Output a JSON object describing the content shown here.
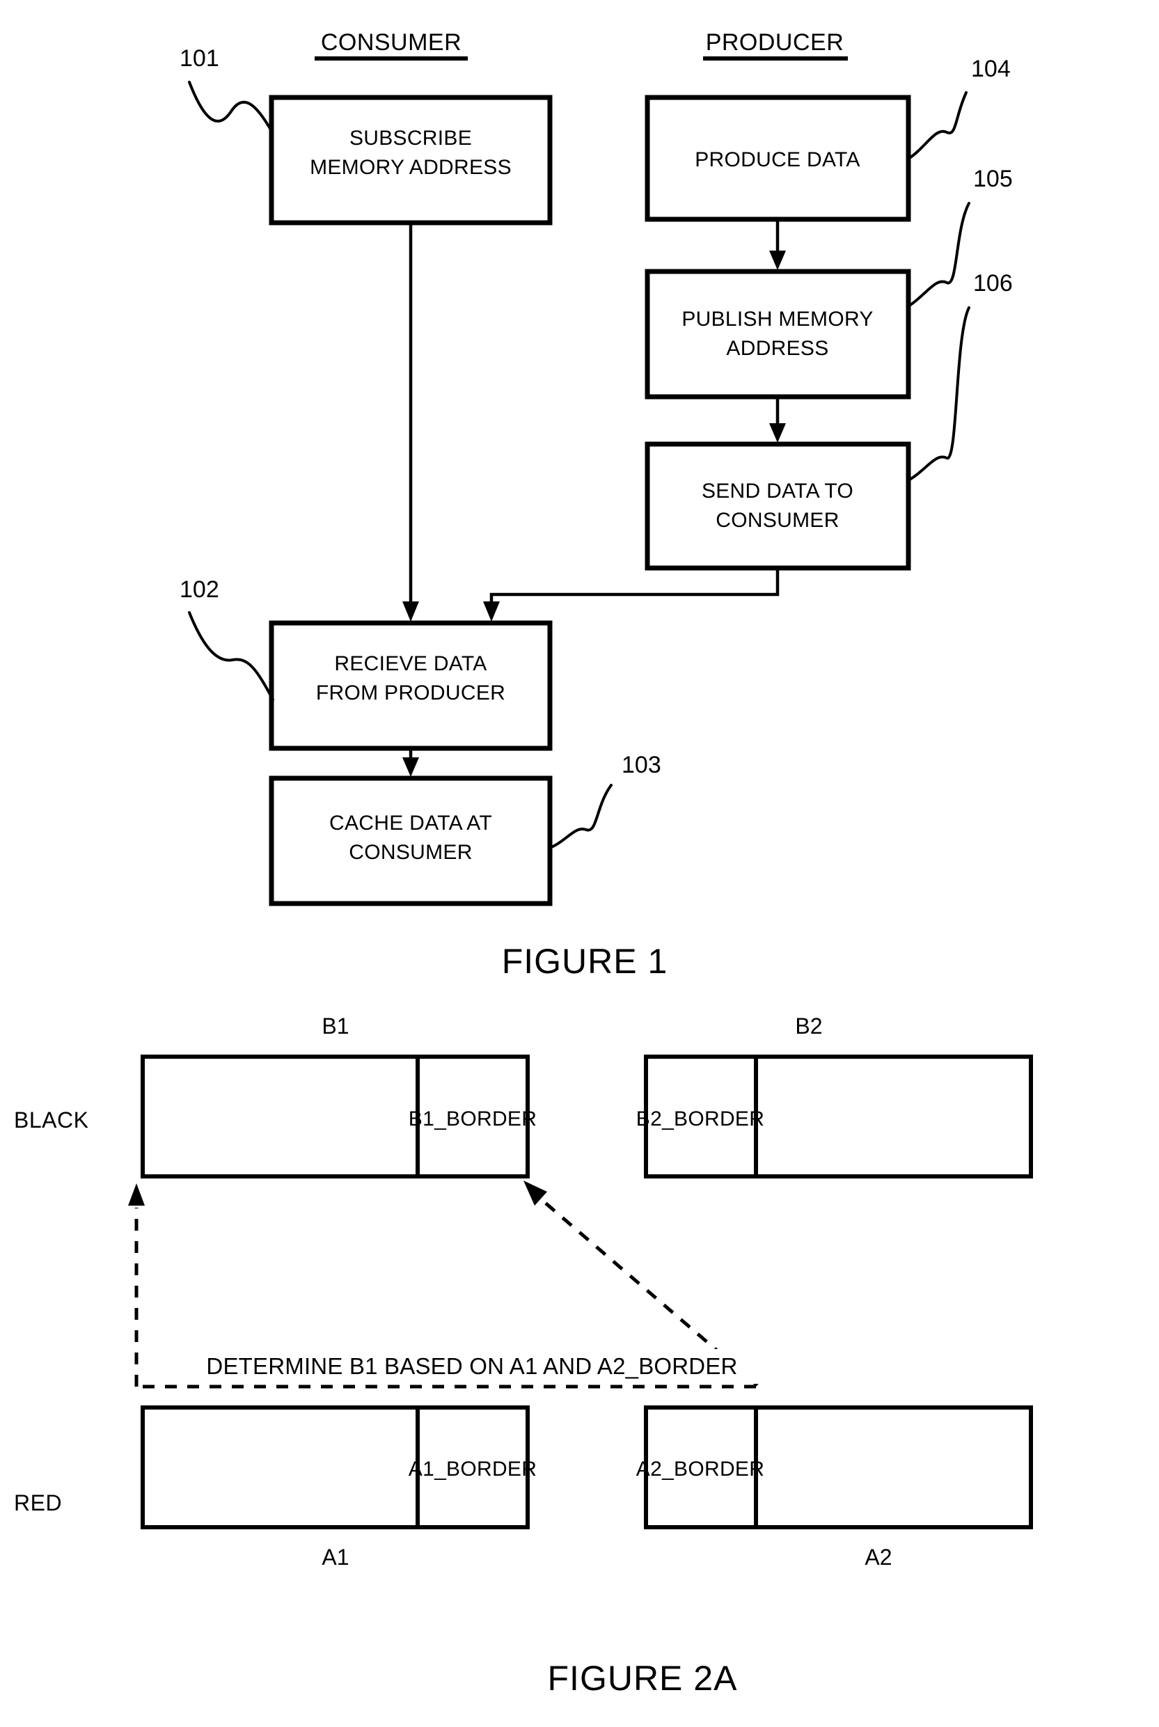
{
  "figure1": {
    "caption": "FIGURE 1",
    "columns": {
      "consumer": "CONSUMER",
      "producer": "PRODUCER"
    },
    "boxes": [
      {
        "id": "subscribe",
        "ref": "101",
        "lines": [
          "SUBSCRIBE",
          "MEMORY ADDRESS"
        ]
      },
      {
        "id": "receive",
        "ref": "102",
        "lines": [
          "RECIEVE DATA",
          "FROM PRODUCER"
        ]
      },
      {
        "id": "cache",
        "ref": "103",
        "lines": [
          "CACHE DATA AT",
          "CONSUMER"
        ]
      },
      {
        "id": "produce",
        "ref": "104",
        "lines": [
          "PRODUCE DATA"
        ]
      },
      {
        "id": "publish",
        "ref": "105",
        "lines": [
          "PUBLISH MEMORY",
          "ADDRESS"
        ]
      },
      {
        "id": "send",
        "ref": "106",
        "lines": [
          "SEND DATA TO",
          "CONSUMER"
        ]
      }
    ]
  },
  "figure2a": {
    "caption": "FIGURE 2A",
    "rows": [
      {
        "id": "black",
        "label": "BLACK"
      },
      {
        "id": "red",
        "label": "RED"
      }
    ],
    "groups": {
      "b1": {
        "label": "B1",
        "cell": "B1_BORDER",
        "cell_side": "right"
      },
      "b2": {
        "label": "B2",
        "cell": "B2_BORDER",
        "cell_side": "left"
      },
      "a1": {
        "label": "A1",
        "cell": "A1_BORDER",
        "cell_side": "right"
      },
      "a2": {
        "label": "A2",
        "cell": "A2_BORDER",
        "cell_side": "left"
      }
    },
    "annotation": "DETERMINE B1 BASED ON A1 AND A2_BORDER"
  },
  "colors": {
    "ink": "#000000",
    "paper": "#ffffff"
  }
}
